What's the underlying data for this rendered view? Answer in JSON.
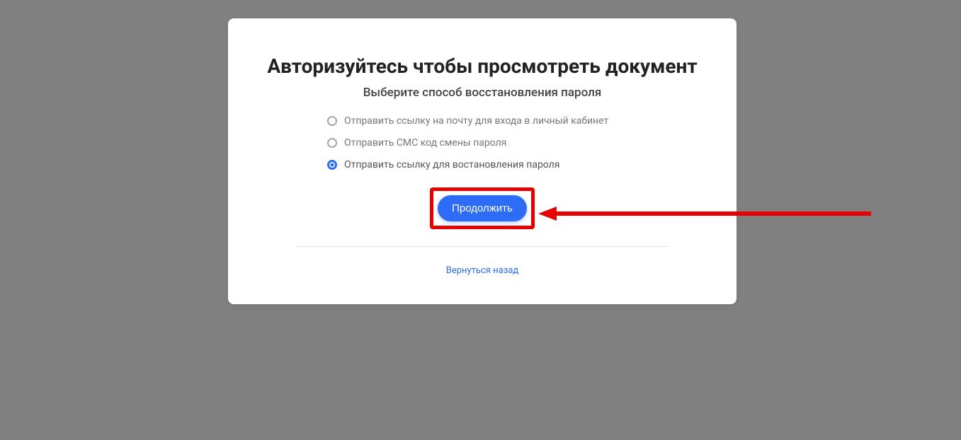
{
  "card": {
    "title": "Авторизуйтесь чтобы просмотреть документ",
    "subtitle": "Выберите способ восстановления пароля",
    "options": [
      {
        "label": "Отправить ссылку на почту для входа в личный кабинет",
        "selected": false
      },
      {
        "label": "Отправить СМС код смены пароля",
        "selected": false
      },
      {
        "label": "Отправить ссылку для востановления пароля",
        "selected": true
      }
    ],
    "continue_label": "Продолжить",
    "back_label": "Вернуться назад"
  },
  "annotation": {
    "highlight_color": "#e60000",
    "arrow_color": "#e60000"
  }
}
